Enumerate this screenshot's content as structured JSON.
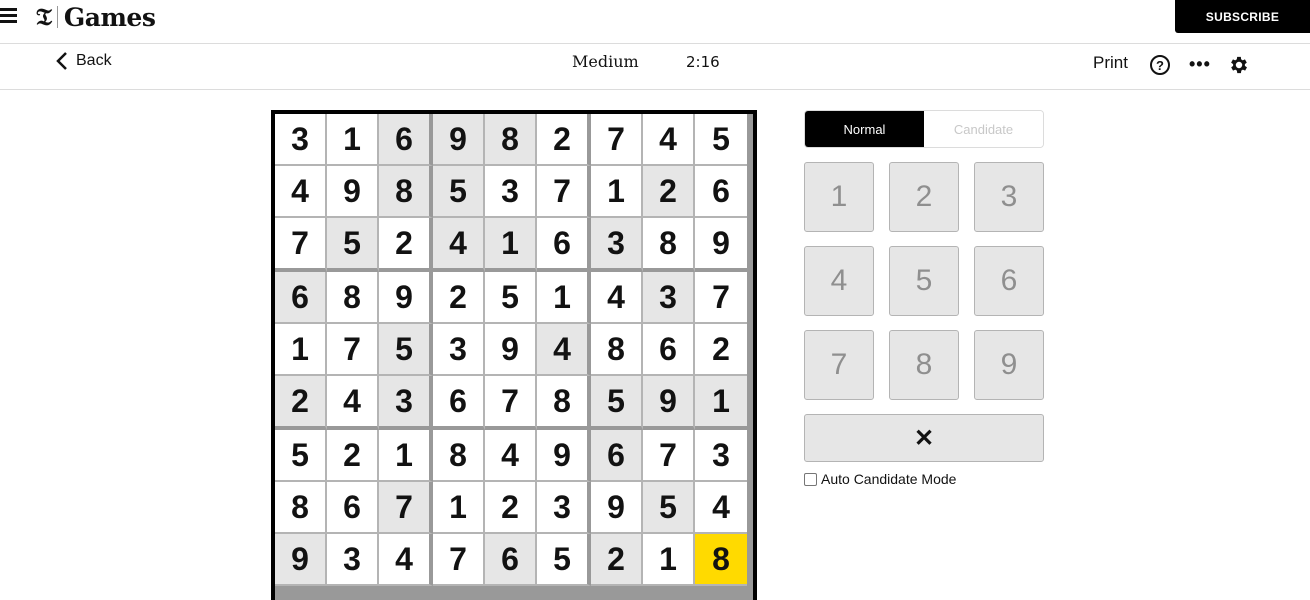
{
  "header": {
    "logo_t": "𝔗",
    "logo_text": "Games",
    "subscribe_label": "SUBSCRIBE",
    "menu_icon": "hamburger-icon"
  },
  "toolbar": {
    "back_label": "Back",
    "difficulty": "Medium",
    "timer": "2:16",
    "print_label": "Print",
    "help_label": "?",
    "more_label": "•••",
    "settings_icon": "gear-icon"
  },
  "board": {
    "selected": [
      8,
      8
    ],
    "rows": [
      [
        {
          "v": "3",
          "s": 0
        },
        {
          "v": "1",
          "s": 0
        },
        {
          "v": "6",
          "s": 1
        },
        {
          "v": "9",
          "s": 1
        },
        {
          "v": "8",
          "s": 1
        },
        {
          "v": "2",
          "s": 0
        },
        {
          "v": "7",
          "s": 0
        },
        {
          "v": "4",
          "s": 0
        },
        {
          "v": "5",
          "s": 0
        }
      ],
      [
        {
          "v": "4",
          "s": 0
        },
        {
          "v": "9",
          "s": 0
        },
        {
          "v": "8",
          "s": 1
        },
        {
          "v": "5",
          "s": 1
        },
        {
          "v": "3",
          "s": 0
        },
        {
          "v": "7",
          "s": 0
        },
        {
          "v": "1",
          "s": 0
        },
        {
          "v": "2",
          "s": 1
        },
        {
          "v": "6",
          "s": 0
        }
      ],
      [
        {
          "v": "7",
          "s": 0
        },
        {
          "v": "5",
          "s": 1
        },
        {
          "v": "2",
          "s": 0
        },
        {
          "v": "4",
          "s": 1
        },
        {
          "v": "1",
          "s": 1
        },
        {
          "v": "6",
          "s": 0
        },
        {
          "v": "3",
          "s": 1
        },
        {
          "v": "8",
          "s": 0
        },
        {
          "v": "9",
          "s": 0
        }
      ],
      [
        {
          "v": "6",
          "s": 1
        },
        {
          "v": "8",
          "s": 0
        },
        {
          "v": "9",
          "s": 0
        },
        {
          "v": "2",
          "s": 0
        },
        {
          "v": "5",
          "s": 0
        },
        {
          "v": "1",
          "s": 0
        },
        {
          "v": "4",
          "s": 0
        },
        {
          "v": "3",
          "s": 1
        },
        {
          "v": "7",
          "s": 0
        }
      ],
      [
        {
          "v": "1",
          "s": 0
        },
        {
          "v": "7",
          "s": 0
        },
        {
          "v": "5",
          "s": 1
        },
        {
          "v": "3",
          "s": 0
        },
        {
          "v": "9",
          "s": 0
        },
        {
          "v": "4",
          "s": 1
        },
        {
          "v": "8",
          "s": 0
        },
        {
          "v": "6",
          "s": 0
        },
        {
          "v": "2",
          "s": 0
        }
      ],
      [
        {
          "v": "2",
          "s": 1
        },
        {
          "v": "4",
          "s": 0
        },
        {
          "v": "3",
          "s": 1
        },
        {
          "v": "6",
          "s": 0
        },
        {
          "v": "7",
          "s": 0
        },
        {
          "v": "8",
          "s": 0
        },
        {
          "v": "5",
          "s": 1
        },
        {
          "v": "9",
          "s": 1
        },
        {
          "v": "1",
          "s": 1
        }
      ],
      [
        {
          "v": "5",
          "s": 0
        },
        {
          "v": "2",
          "s": 0
        },
        {
          "v": "1",
          "s": 0
        },
        {
          "v": "8",
          "s": 0
        },
        {
          "v": "4",
          "s": 0
        },
        {
          "v": "9",
          "s": 0
        },
        {
          "v": "6",
          "s": 1
        },
        {
          "v": "7",
          "s": 0
        },
        {
          "v": "3",
          "s": 0
        }
      ],
      [
        {
          "v": "8",
          "s": 0
        },
        {
          "v": "6",
          "s": 0
        },
        {
          "v": "7",
          "s": 1
        },
        {
          "v": "1",
          "s": 0
        },
        {
          "v": "2",
          "s": 0
        },
        {
          "v": "3",
          "s": 0
        },
        {
          "v": "9",
          "s": 0
        },
        {
          "v": "5",
          "s": 1
        },
        {
          "v": "4",
          "s": 0
        }
      ],
      [
        {
          "v": "9",
          "s": 1
        },
        {
          "v": "3",
          "s": 0
        },
        {
          "v": "4",
          "s": 0
        },
        {
          "v": "7",
          "s": 0
        },
        {
          "v": "6",
          "s": 1
        },
        {
          "v": "5",
          "s": 0
        },
        {
          "v": "2",
          "s": 1
        },
        {
          "v": "1",
          "s": 0
        },
        {
          "v": "8",
          "s": 0
        }
      ]
    ]
  },
  "panel": {
    "modes": [
      {
        "label": "Normal",
        "active": true
      },
      {
        "label": "Candidate",
        "active": false
      }
    ],
    "keys": [
      "1",
      "2",
      "3",
      "4",
      "5",
      "6",
      "7",
      "8",
      "9"
    ],
    "erase_label": "✕",
    "auto_candidate_label": "Auto Candidate Mode",
    "auto_candidate_checked": false
  },
  "colors": {
    "selected_cell": "#ffda00",
    "shaded_cell": "#e6e6e6",
    "accent": "#000000"
  }
}
